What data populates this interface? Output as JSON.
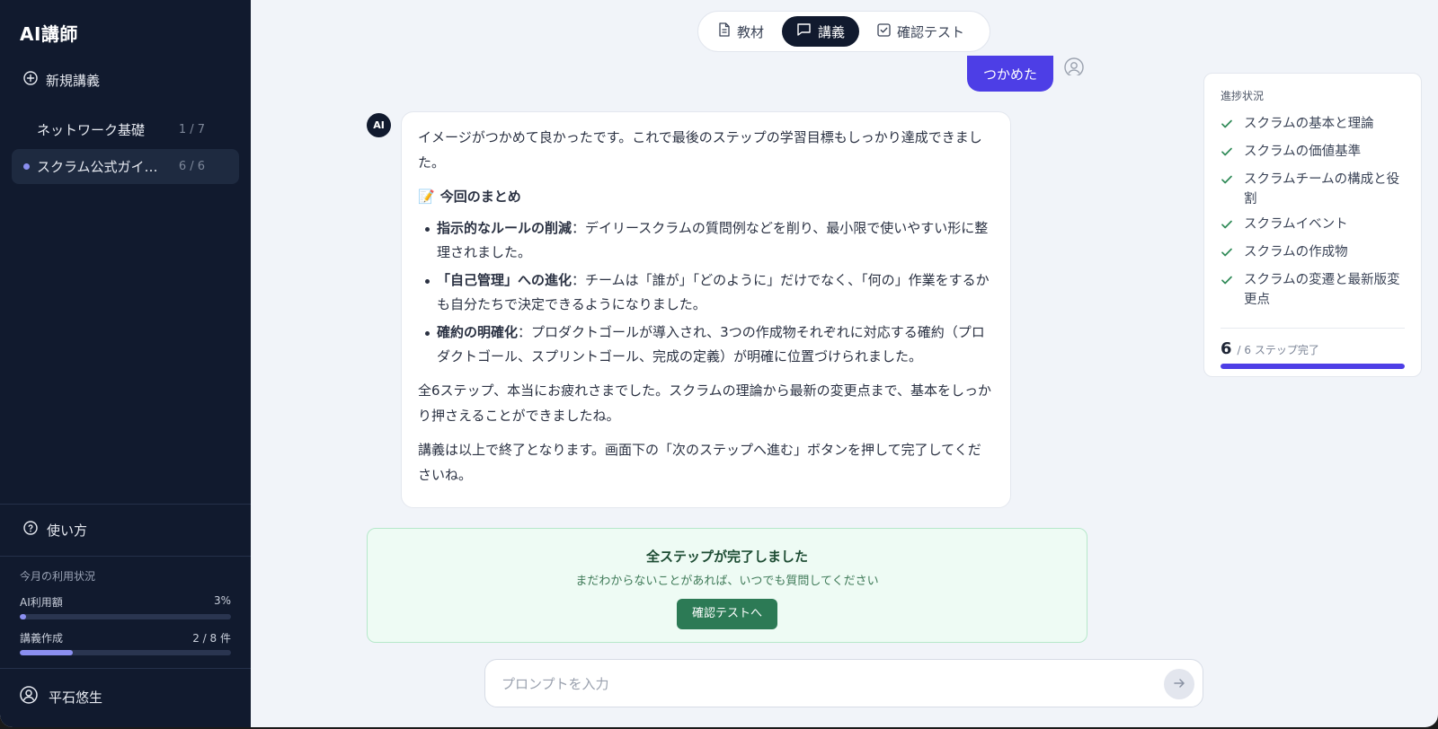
{
  "sidebar": {
    "brand": "AI講師",
    "new_lecture": "新規講義",
    "lectures": [
      {
        "name": "ネットワーク基礎",
        "count": "1 / 7",
        "active": false
      },
      {
        "name": "スクラム公式ガイ…",
        "count": "6 / 6",
        "active": true
      }
    ],
    "help": "使い方",
    "usage": {
      "title": "今月の利用状況",
      "ai_label": "AI利用額",
      "ai_value": "3%",
      "ai_fraction": 0.03,
      "create_label": "講義作成",
      "create_value": "2 / 8 件",
      "create_fraction": 0.25
    },
    "user_name": "平石悠生"
  },
  "tabs": [
    {
      "label": "教材",
      "icon": "document-icon",
      "active": false
    },
    {
      "label": "講義",
      "icon": "chat-icon",
      "active": true
    },
    {
      "label": "確認テスト",
      "icon": "checkbox-icon",
      "active": false
    }
  ],
  "chat": {
    "user_message": "つかめた",
    "ai_avatar": "AI",
    "ai_message": {
      "intro": "イメージがつかめて良かったです。これで最後のステップの学習目標もしっかり達成できました。",
      "summary_emoji": "📝",
      "summary_title": "今回のまとめ",
      "bullets": [
        {
          "bold": "指示的なルールの削減",
          "text": "：デイリースクラムの質問例などを削り、最小限で使いやすい形に整理されました。"
        },
        {
          "bold": "「自己管理」への進化",
          "text": "：チームは「誰が」「どのように」だけでなく、「何の」作業をするかも自分たちで決定できるようになりました。"
        },
        {
          "bold": "確約の明確化",
          "text": "：プロダクトゴールが導入され、3つの作成物それぞれに対応する確約（プロダクトゴール、スプリントゴール、完成の定義）が明確に位置づけられました。"
        }
      ],
      "closing1": "全6ステップ、本当にお疲れさまでした。スクラムの理論から最新の変更点まで、基本をしっかり押さえることができましたね。",
      "closing2": "講義は以上で終了となります。画面下の「次のステップへ進む」ボタンを押して完了してくださいね。"
    }
  },
  "completion": {
    "title": "全ステップが完了しました",
    "subtitle": "まだわからないことがあれば、いつでも質問してください",
    "button": "確認テストへ"
  },
  "prompt": {
    "placeholder": "プロンプトを入力"
  },
  "progress": {
    "title": "進捗状況",
    "steps": [
      "スクラムの基本と理論",
      "スクラムの価値基準",
      "スクラムチームの構成と役割",
      "スクラムイベント",
      "スクラムの作成物",
      "スクラムの変遷と最新版変更点"
    ],
    "done": "6",
    "total_label": "/ 6 ステップ完了",
    "fraction": 1.0
  },
  "colors": {
    "sidebar_bg": "#111a2e",
    "accent": "#4d3ee6",
    "success": "#2c7a55",
    "check": "#2f8a57"
  }
}
